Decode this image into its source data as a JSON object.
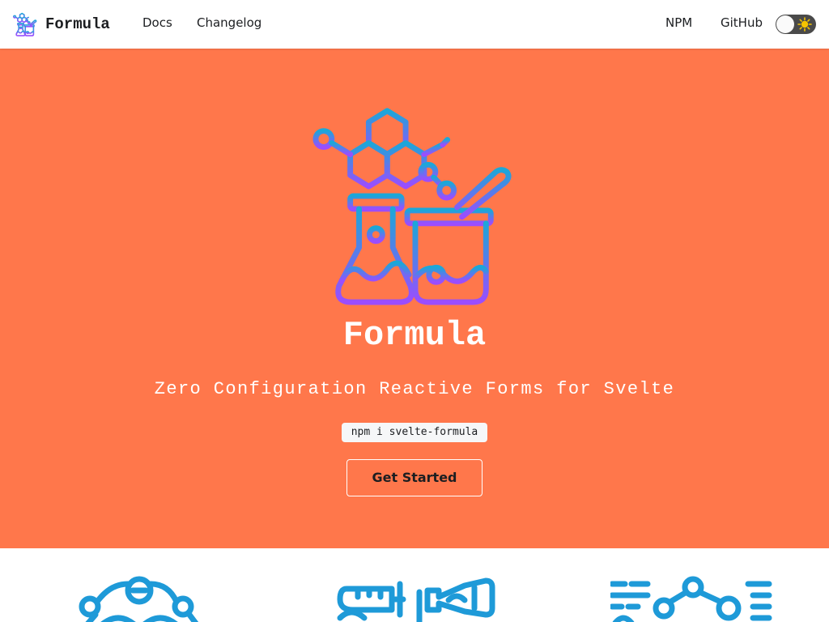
{
  "navbar": {
    "brand": "Formula",
    "links": [
      "Docs",
      "Changelog"
    ],
    "right_links": [
      "NPM",
      "GitHub"
    ],
    "theme_toggle": "off"
  },
  "hero": {
    "title": "Formula",
    "tagline": "Zero Configuration Reactive Forms for Svelte",
    "install": "npm i svelte-formula",
    "cta": "Get Started"
  },
  "colors": {
    "hero_bg": "#ff774b",
    "gradient_top": "#1ca7d8",
    "gradient_bottom": "#9b4dff",
    "feature_blue": "#1e9ad8",
    "text_dark": "#1c1e21"
  },
  "icons": {
    "brand": "chemistry-lab-icon",
    "hero": "chemistry-lab-icon",
    "toggle": "sun-icon",
    "features": [
      "network-nodes-icon",
      "test-tubes-icon",
      "molecule-chart-icon"
    ]
  }
}
